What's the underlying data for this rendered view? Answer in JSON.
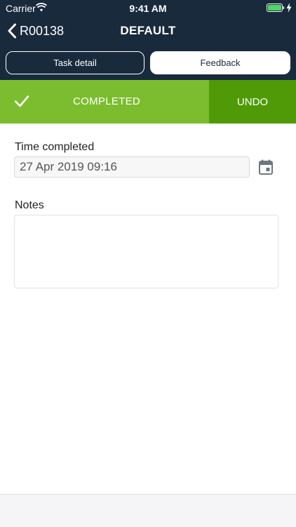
{
  "status_bar": {
    "carrier": "Carrier",
    "time": "9:41 AM"
  },
  "nav": {
    "back_label": "R00138",
    "title": "DEFAULT"
  },
  "tabs": {
    "task_detail": "Task detail",
    "feedback": "Feedback",
    "selected": "Feedback"
  },
  "status": {
    "label": "COMPLETED",
    "undo": "UNDO"
  },
  "form": {
    "time_label": "Time completed",
    "time_value": "27 Apr 2019 09:16",
    "notes_label": "Notes",
    "notes_value": ""
  },
  "colors": {
    "header": "#1a2a3d",
    "completed": "#7cbd2f",
    "undo": "#4f9a06"
  },
  "icons": [
    "wifi-icon",
    "battery-icon",
    "charge-icon",
    "back-chevron-icon",
    "check-icon",
    "calendar-icon"
  ]
}
